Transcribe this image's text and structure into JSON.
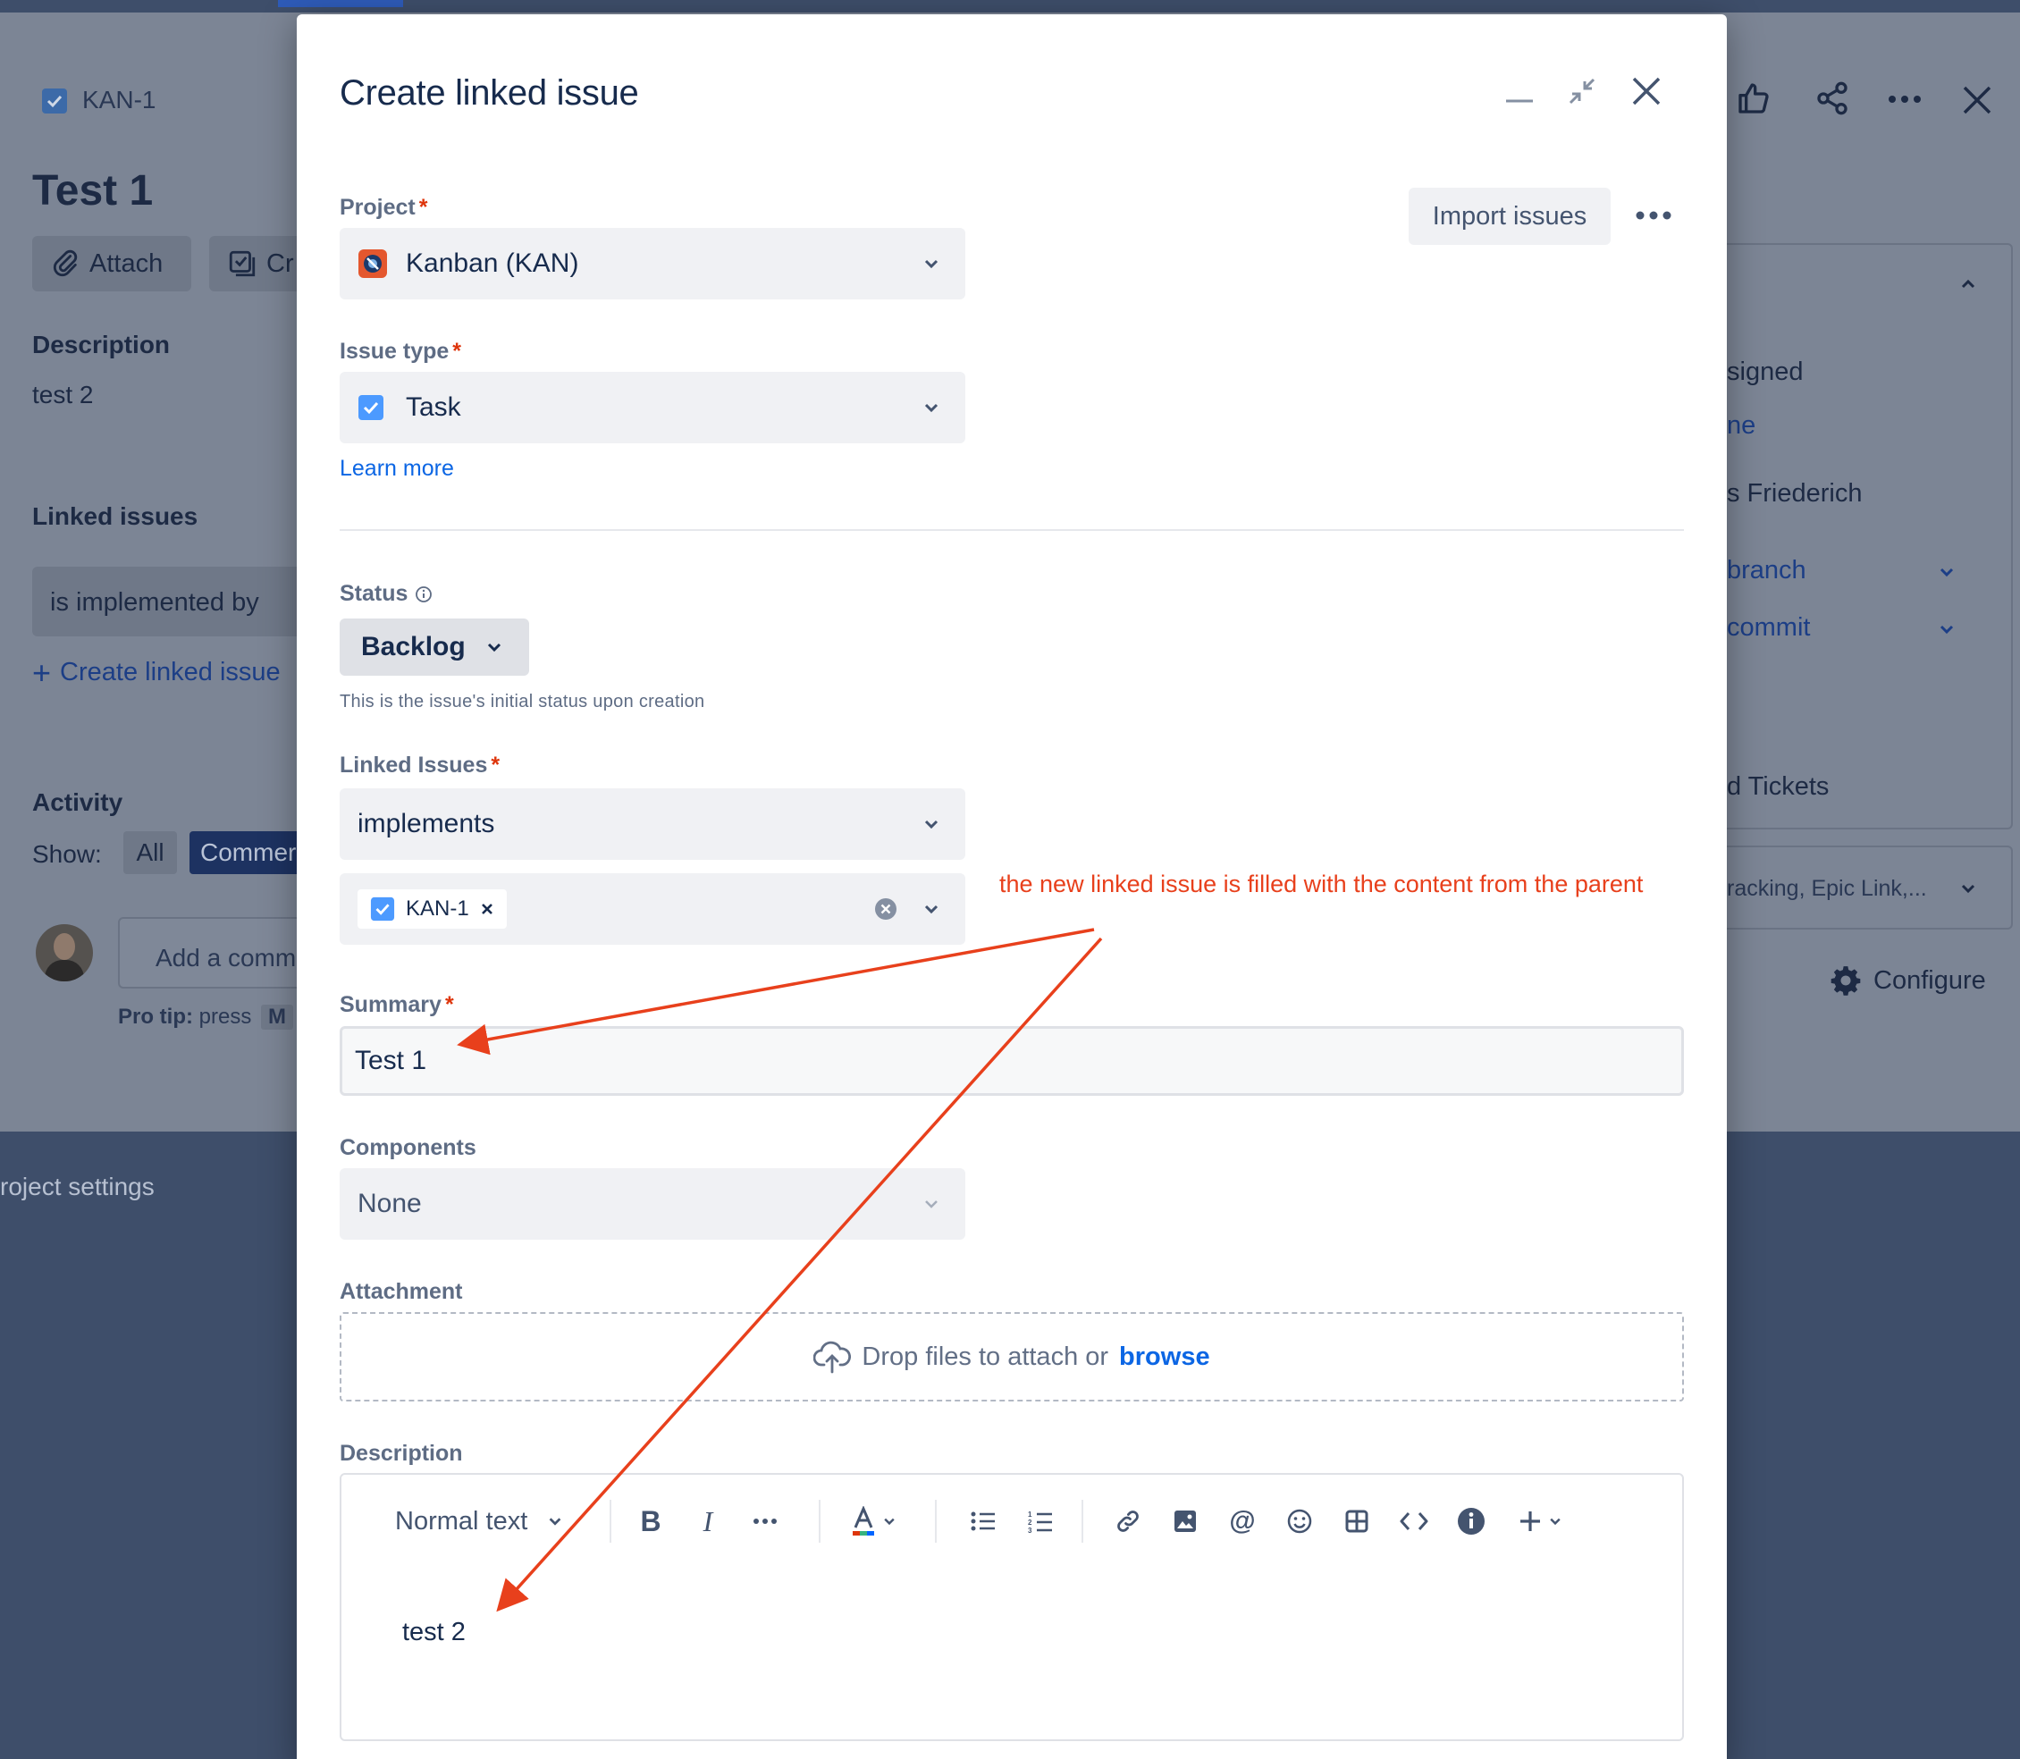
{
  "background": {
    "issue_key": "KAN-1",
    "issue_title": "Test 1",
    "attach_label": "Attach",
    "create_label": "Cr",
    "description_heading": "Description",
    "description_text": "test 2",
    "linked_issues_heading": "Linked issues",
    "link_relation": "is implemented by",
    "create_linked_issue_label": "Create linked issue",
    "activity_heading": "Activity",
    "show_label": "Show:",
    "filter_all": "All",
    "filter_comments": "Commer",
    "comment_placeholder": "Add a comm",
    "pro_tip_bold": "Pro tip:",
    "pro_tip_text": "press",
    "pro_tip_key": "M",
    "project_settings": "roject settings",
    "right_panel": {
      "assignee_text": "signed",
      "assign_me": "ne",
      "reporter": "s Friederich",
      "branch": "branch",
      "commit": "commit",
      "tickets": "d Tickets",
      "more_fields": "racking, Epic Link,...",
      "configure": "Configure"
    }
  },
  "modal": {
    "title": "Create linked issue",
    "import_label": "Import issues",
    "project": {
      "label": "Project",
      "value": "Kanban (KAN)"
    },
    "issue_type": {
      "label": "Issue type",
      "value": "Task",
      "learn_more": "Learn more"
    },
    "status": {
      "label": "Status",
      "value": "Backlog",
      "helper": "This is the issue's initial status upon creation"
    },
    "linked_issues": {
      "label": "Linked Issues",
      "relation": "implements",
      "chip": "KAN-1"
    },
    "summary": {
      "label": "Summary",
      "value": "Test 1"
    },
    "components": {
      "label": "Components",
      "value": "None"
    },
    "attachment": {
      "label": "Attachment",
      "drop_text": "Drop files to attach or",
      "browse": "browse"
    },
    "description": {
      "label": "Description",
      "text_style": "Normal text",
      "body": "test 2"
    }
  },
  "annotation": {
    "text": "the new linked issue is filled with the content from the parent",
    "color": "#e8401c"
  },
  "colors": {
    "accent": "#0c66e4",
    "required": "#de350b",
    "task_blue": "#4c9aff"
  }
}
